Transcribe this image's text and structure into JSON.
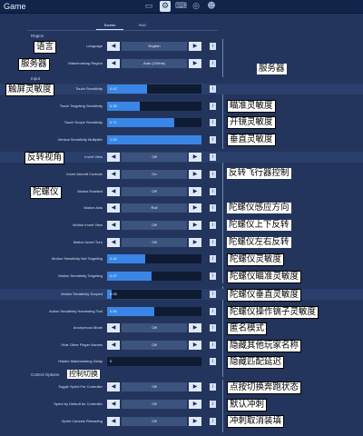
{
  "window": {
    "title": "Game"
  },
  "top_icons": [
    "monitor-icon",
    "gear-icon",
    "gamepad-icon",
    "controller-icon",
    "user-icon"
  ],
  "tabs": [
    {
      "label": "Screen",
      "selected": true
    },
    {
      "label": "HUD",
      "selected": false
    }
  ],
  "sections": {
    "region": "Region",
    "input": "Input",
    "control_options": "Control Options"
  },
  "rows": {
    "language": {
      "label": "Language",
      "value": "English"
    },
    "matchmaking_region": {
      "label": "Matchmaking Region",
      "value": "Auto (100ms)"
    },
    "touch_sensitivity": {
      "label": "Touch Sensitivity",
      "value": "0.42",
      "fraction": 0.42
    },
    "touch_targeting_sensitivity": {
      "label": "Touch Targeting Sensitivity",
      "value": "0.35",
      "fraction": 0.35
    },
    "touch_scope_sensitivity": {
      "label": "Touch Scope Sensitivity",
      "value": "0.71",
      "fraction": 0.71
    },
    "vertical_sensitivity_multiplier": {
      "label": "Vertical Sensitivity Multiplier",
      "value": "1.00",
      "fraction": 1.0
    },
    "invert_view": {
      "label": "Invert View",
      "value": "Off"
    },
    "invert_aircraft_controls": {
      "label": "Invert Aircraft Controls",
      "value": "On"
    },
    "motion_enabled": {
      "label": "Motion Enabled",
      "value": "Off"
    },
    "motion_axis": {
      "label": "Motion Axis",
      "value": "Roll"
    },
    "motion_invert_view": {
      "label": "Motion Invert View",
      "value": "Off"
    },
    "motion_invert_turn": {
      "label": "Motion Invert Turn",
      "value": "Off"
    },
    "motion_sensitivity_not_targeting": {
      "label": "Motion Sensitivity Not Targeting",
      "value": "0.40",
      "fraction": 0.4
    },
    "motion_sensitivity_targeting": {
      "label": "Motion Sensitivity Targeting",
      "value": "0.47",
      "fraction": 0.47
    },
    "motion_sensitivity_scoped": {
      "label": "Motion Sensitivity Scoped",
      "value": "0.05",
      "fraction": 0.05
    },
    "action_sensitivity_harvesting_tool": {
      "label": "Action Sensitivity Harvesting Tool",
      "value": "0.50",
      "fraction": 0.5
    },
    "anonymous_mode": {
      "label": "Anonymous Mode",
      "value": "Off"
    },
    "hide_other_player_names": {
      "label": "Hide Other Player Names",
      "value": "Off"
    },
    "hidden_matchmaking_delay": {
      "label": "Hidden Matchmaking Delay",
      "value": "0",
      "fraction": 0.0
    },
    "toggle_sprint_for_controller": {
      "label": "Toggle Sprint For Controller",
      "value": "Off"
    },
    "sprint_by_default_for_controller": {
      "label": "Sprint by Default for Controller",
      "value": "Off"
    },
    "sprint_cancels_reloading": {
      "label": "Sprint Cancels Reloading",
      "value": "Off"
    }
  },
  "annotations": {
    "language": "语言",
    "server_left": "服务器",
    "server_right": "服务器",
    "touch_sensitivity": "触屏灵敏度",
    "targeting_sensitivity": "瞄准灵敏度",
    "scope_sensitivity": "开镜灵敏度",
    "vertical_sensitivity": "垂直灵敏度",
    "invert_view": "反转视角",
    "invert_aircraft": "反转飞行器控制",
    "gyroscope": "陀螺仪",
    "gyro_axis": "陀螺仪感应方向",
    "gyro_up_down": "陀螺仪上下反转",
    "gyro_left_right": "陀螺仪左右反转",
    "gyro_sensitivity": "陀螺仪灵敏度",
    "gyro_aim_sensitivity": "陀螺仪瞄准灵敏度",
    "gyro_vertical_sensitivity": "陀螺仪垂直灵敏度",
    "gyro_harvest_sensitivity": "陀螺仪操作镐子灵敏度",
    "anonymous_mode": "匿名模式",
    "hide_names": "隐藏其他玩家名称",
    "hide_delay": "隐藏匹配延迟",
    "control_toggle": "控制切换",
    "sprint_toggle": "点按切换奔跑状态",
    "sprint_default": "默认冲刺",
    "sprint_cancel": "冲刺取消装填"
  },
  "colors": {
    "background": "#23355c",
    "topbar": "#11244a",
    "slider_fill": "#3a86e6",
    "slider_track": "#0e1b33"
  }
}
